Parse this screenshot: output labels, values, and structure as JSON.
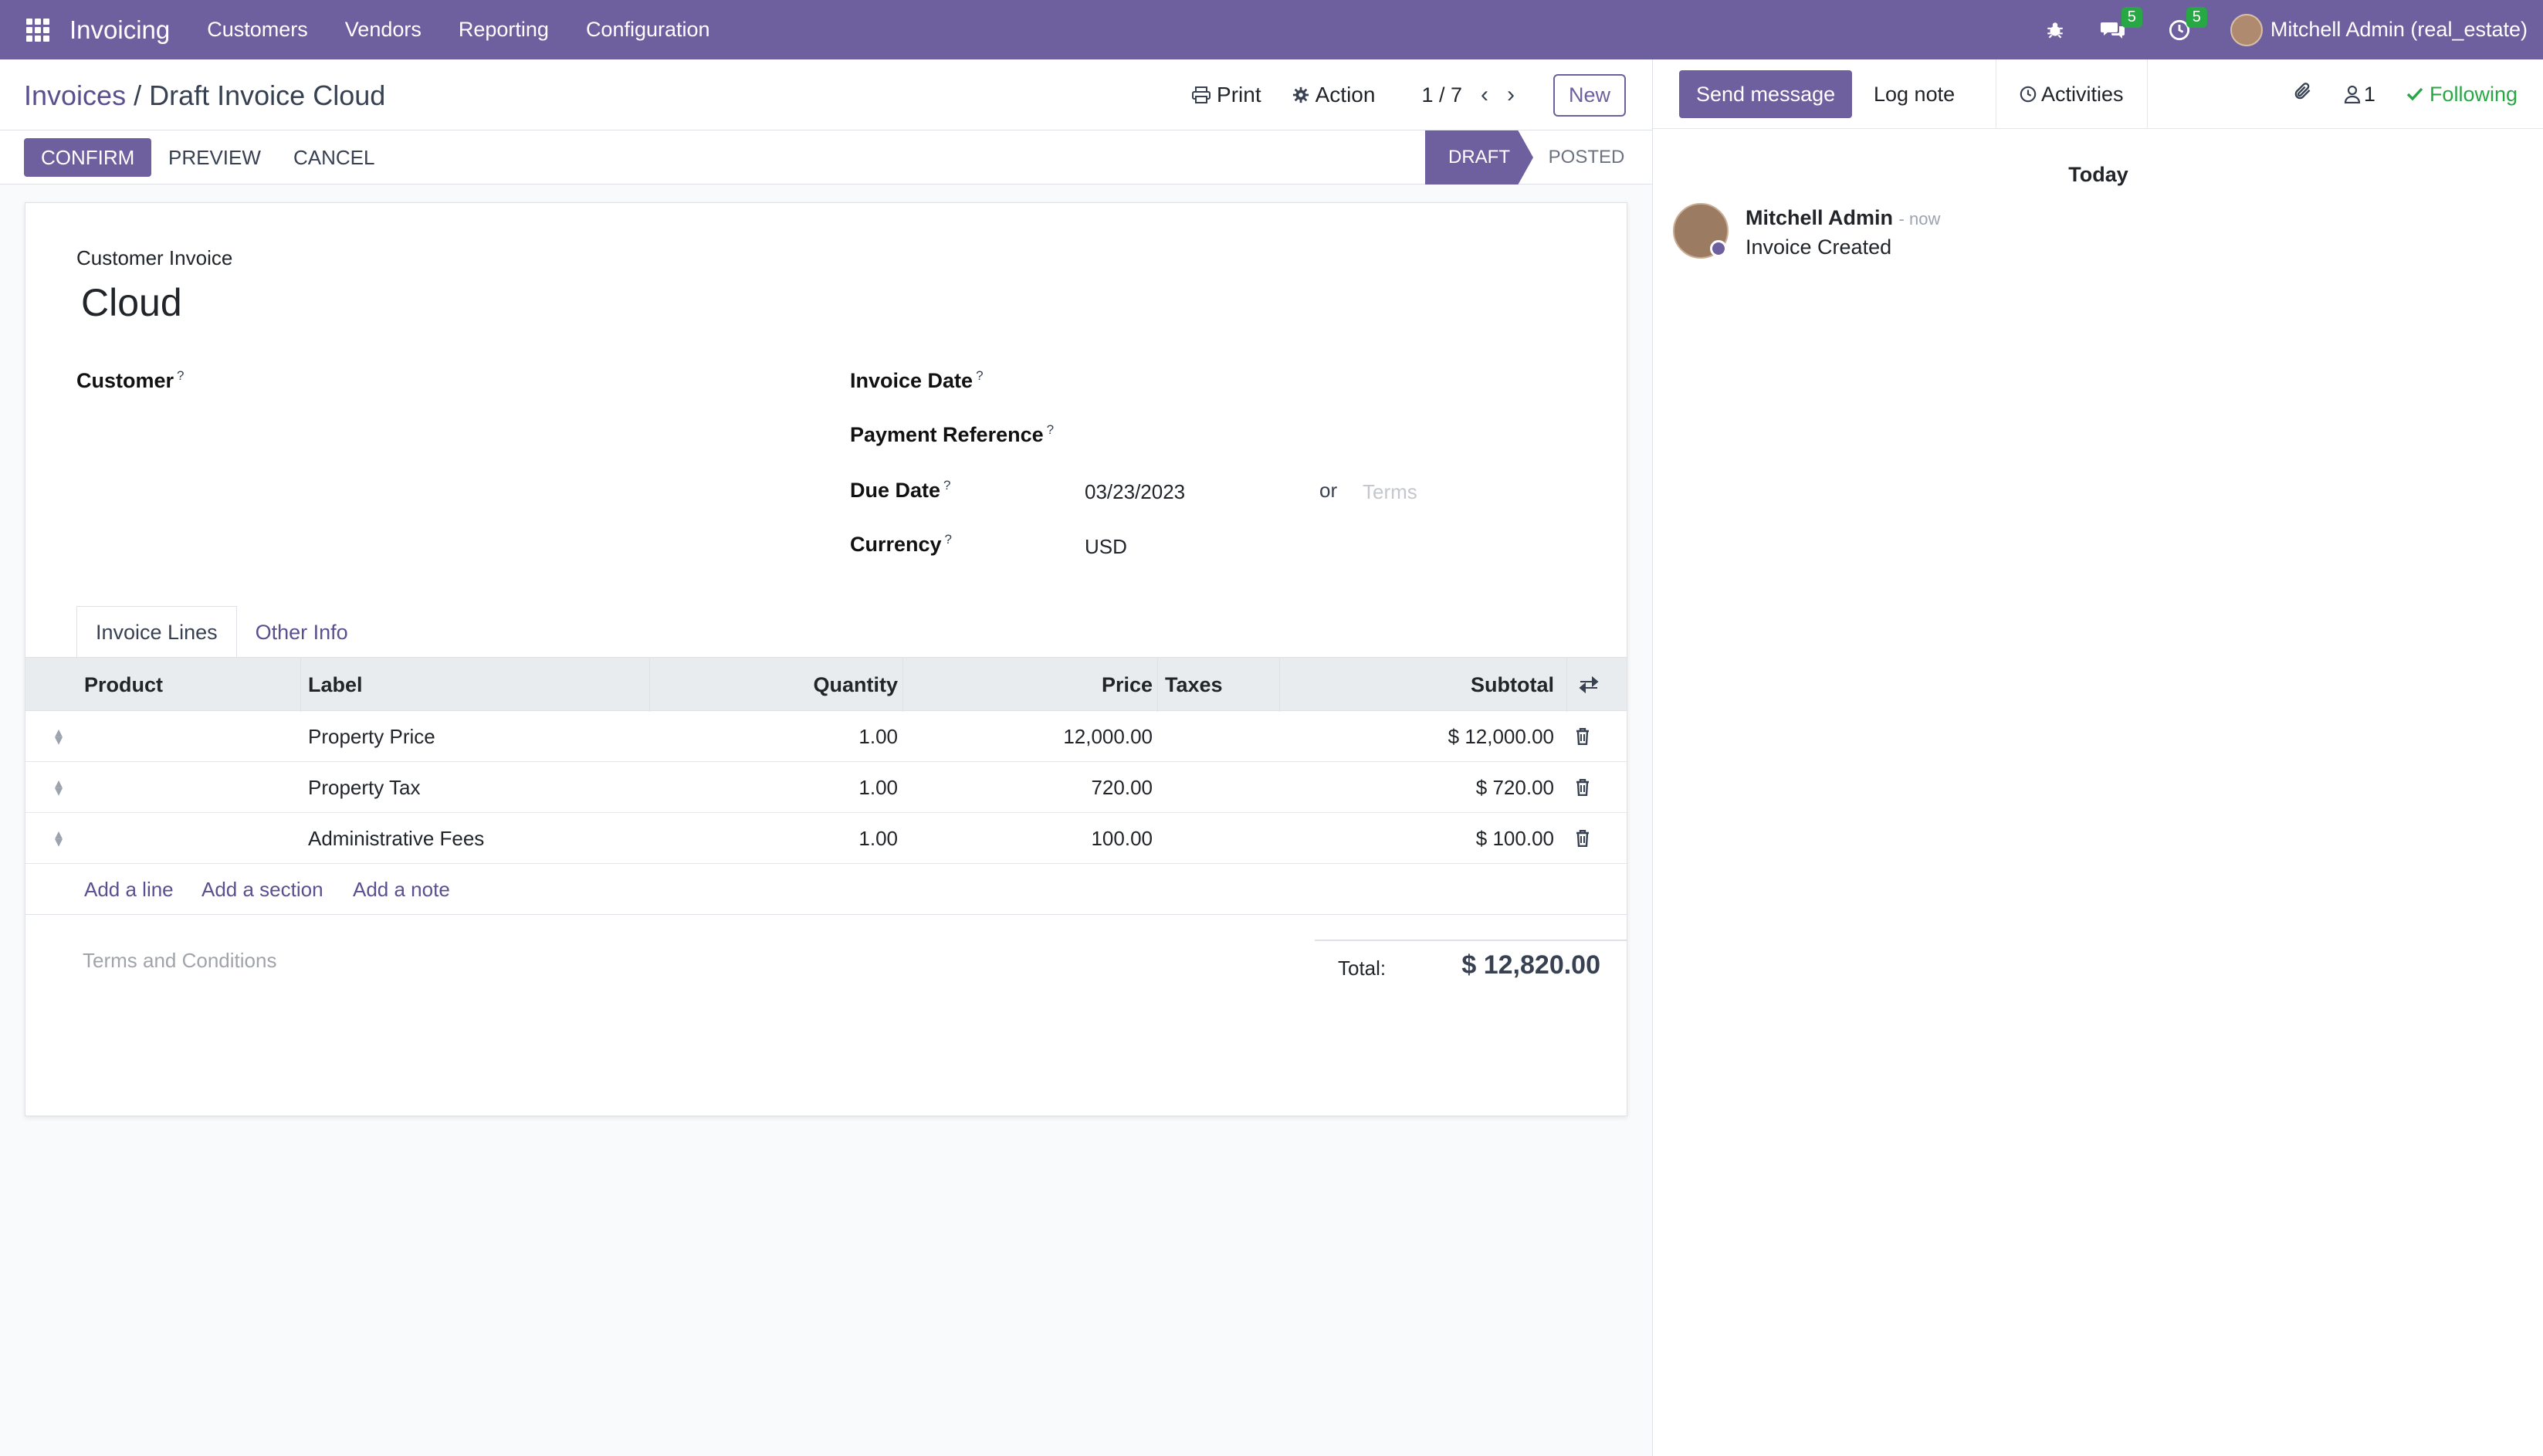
{
  "navbar": {
    "app_name": "Invoicing",
    "menus": [
      "Customers",
      "Vendors",
      "Reporting",
      "Configuration"
    ],
    "messages_badge": "5",
    "activities_badge": "5",
    "user": "Mitchell Admin (real_estate)"
  },
  "control": {
    "breadcrumb_parent": "Invoices",
    "breadcrumb_sep": "/",
    "breadcrumb_current": "Draft Invoice Cloud",
    "print_label": "Print",
    "action_label": "Action",
    "pager": "1 / 7",
    "new_label": "New"
  },
  "statusbar": {
    "confirm": "CONFIRM",
    "preview": "PREVIEW",
    "cancel": "CANCEL",
    "stage_draft": "DRAFT",
    "stage_posted": "POSTED"
  },
  "form": {
    "doc_type": "Customer Invoice",
    "doc_name": "Cloud",
    "customer_label": "Customer",
    "invoice_date_label": "Invoice Date",
    "payment_ref_label": "Payment Reference",
    "due_date_label": "Due Date",
    "due_date_value": "03/23/2023",
    "or_text": "or",
    "terms_placeholder": "Terms",
    "currency_label": "Currency",
    "currency_value": "USD",
    "help_mark": "?"
  },
  "tabs": [
    "Invoice Lines",
    "Other Info"
  ],
  "table": {
    "headers": {
      "product": "Product",
      "label": "Label",
      "quantity": "Quantity",
      "price": "Price",
      "taxes": "Taxes",
      "subtotal": "Subtotal"
    },
    "rows": [
      {
        "label": "Property Price",
        "quantity": "1.00",
        "price": "12,000.00",
        "subtotal": "$ 12,000.00"
      },
      {
        "label": "Property Tax",
        "quantity": "1.00",
        "price": "720.00",
        "subtotal": "$ 720.00"
      },
      {
        "label": "Administrative Fees",
        "quantity": "1.00",
        "price": "100.00",
        "subtotal": "$ 100.00"
      }
    ],
    "add_line": "Add a line",
    "add_section": "Add a section",
    "add_note": "Add a note"
  },
  "footer": {
    "terms_placeholder": "Terms and Conditions",
    "total_label": "Total:",
    "total_value": "$ 12,820.00"
  },
  "chatter": {
    "send_message": "Send message",
    "log_note": "Log note",
    "activities": "Activities",
    "followers_count": "1",
    "following": "Following",
    "date_separator": "Today",
    "message_author": "Mitchell Admin",
    "message_time": "- now",
    "message_body": "Invoice Created"
  },
  "colors": {
    "brand": "#6e5f9e",
    "success": "#28a745"
  }
}
